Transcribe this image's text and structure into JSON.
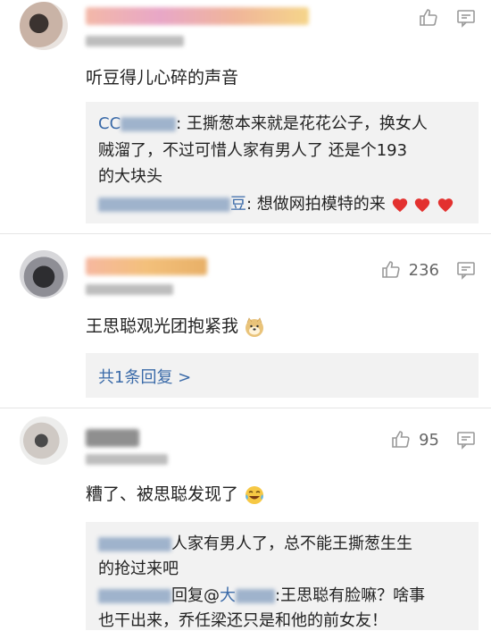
{
  "comments": [
    {
      "text": "听豆得儿心碎的声音",
      "replies": [
        {
          "name": "CC",
          "body": ": 王撕葱本来就是花花公子，换女人"
        },
        {
          "body": "贼溜了，不过可惜人家有男人了  还是个193"
        },
        {
          "body": "的大块头"
        },
        {
          "name": "豆",
          "body": ": 想做网拍模特的来"
        }
      ]
    },
    {
      "text": "王思聪观光团抱紧我",
      "likes": "236",
      "more_replies": "共1条回复 >"
    },
    {
      "text": "糟了、被思聪发现了",
      "likes": "95",
      "replies": [
        {
          "body": "人家有男人了，总不能王撕葱生生"
        },
        {
          "body": "的抢过来吧"
        },
        {
          "prefix": "回复@",
          "name": "大",
          "body": ":王思聪有脸嘛？啥事"
        },
        {
          "body": "也干出来，乔任梁还只是和他的前女友！"
        }
      ]
    }
  ],
  "icons": [
    "thumbs-up-icon",
    "comment-icon",
    "heart-icon",
    "doge-emoji-icon",
    "laugh-cry-emoji-icon"
  ]
}
